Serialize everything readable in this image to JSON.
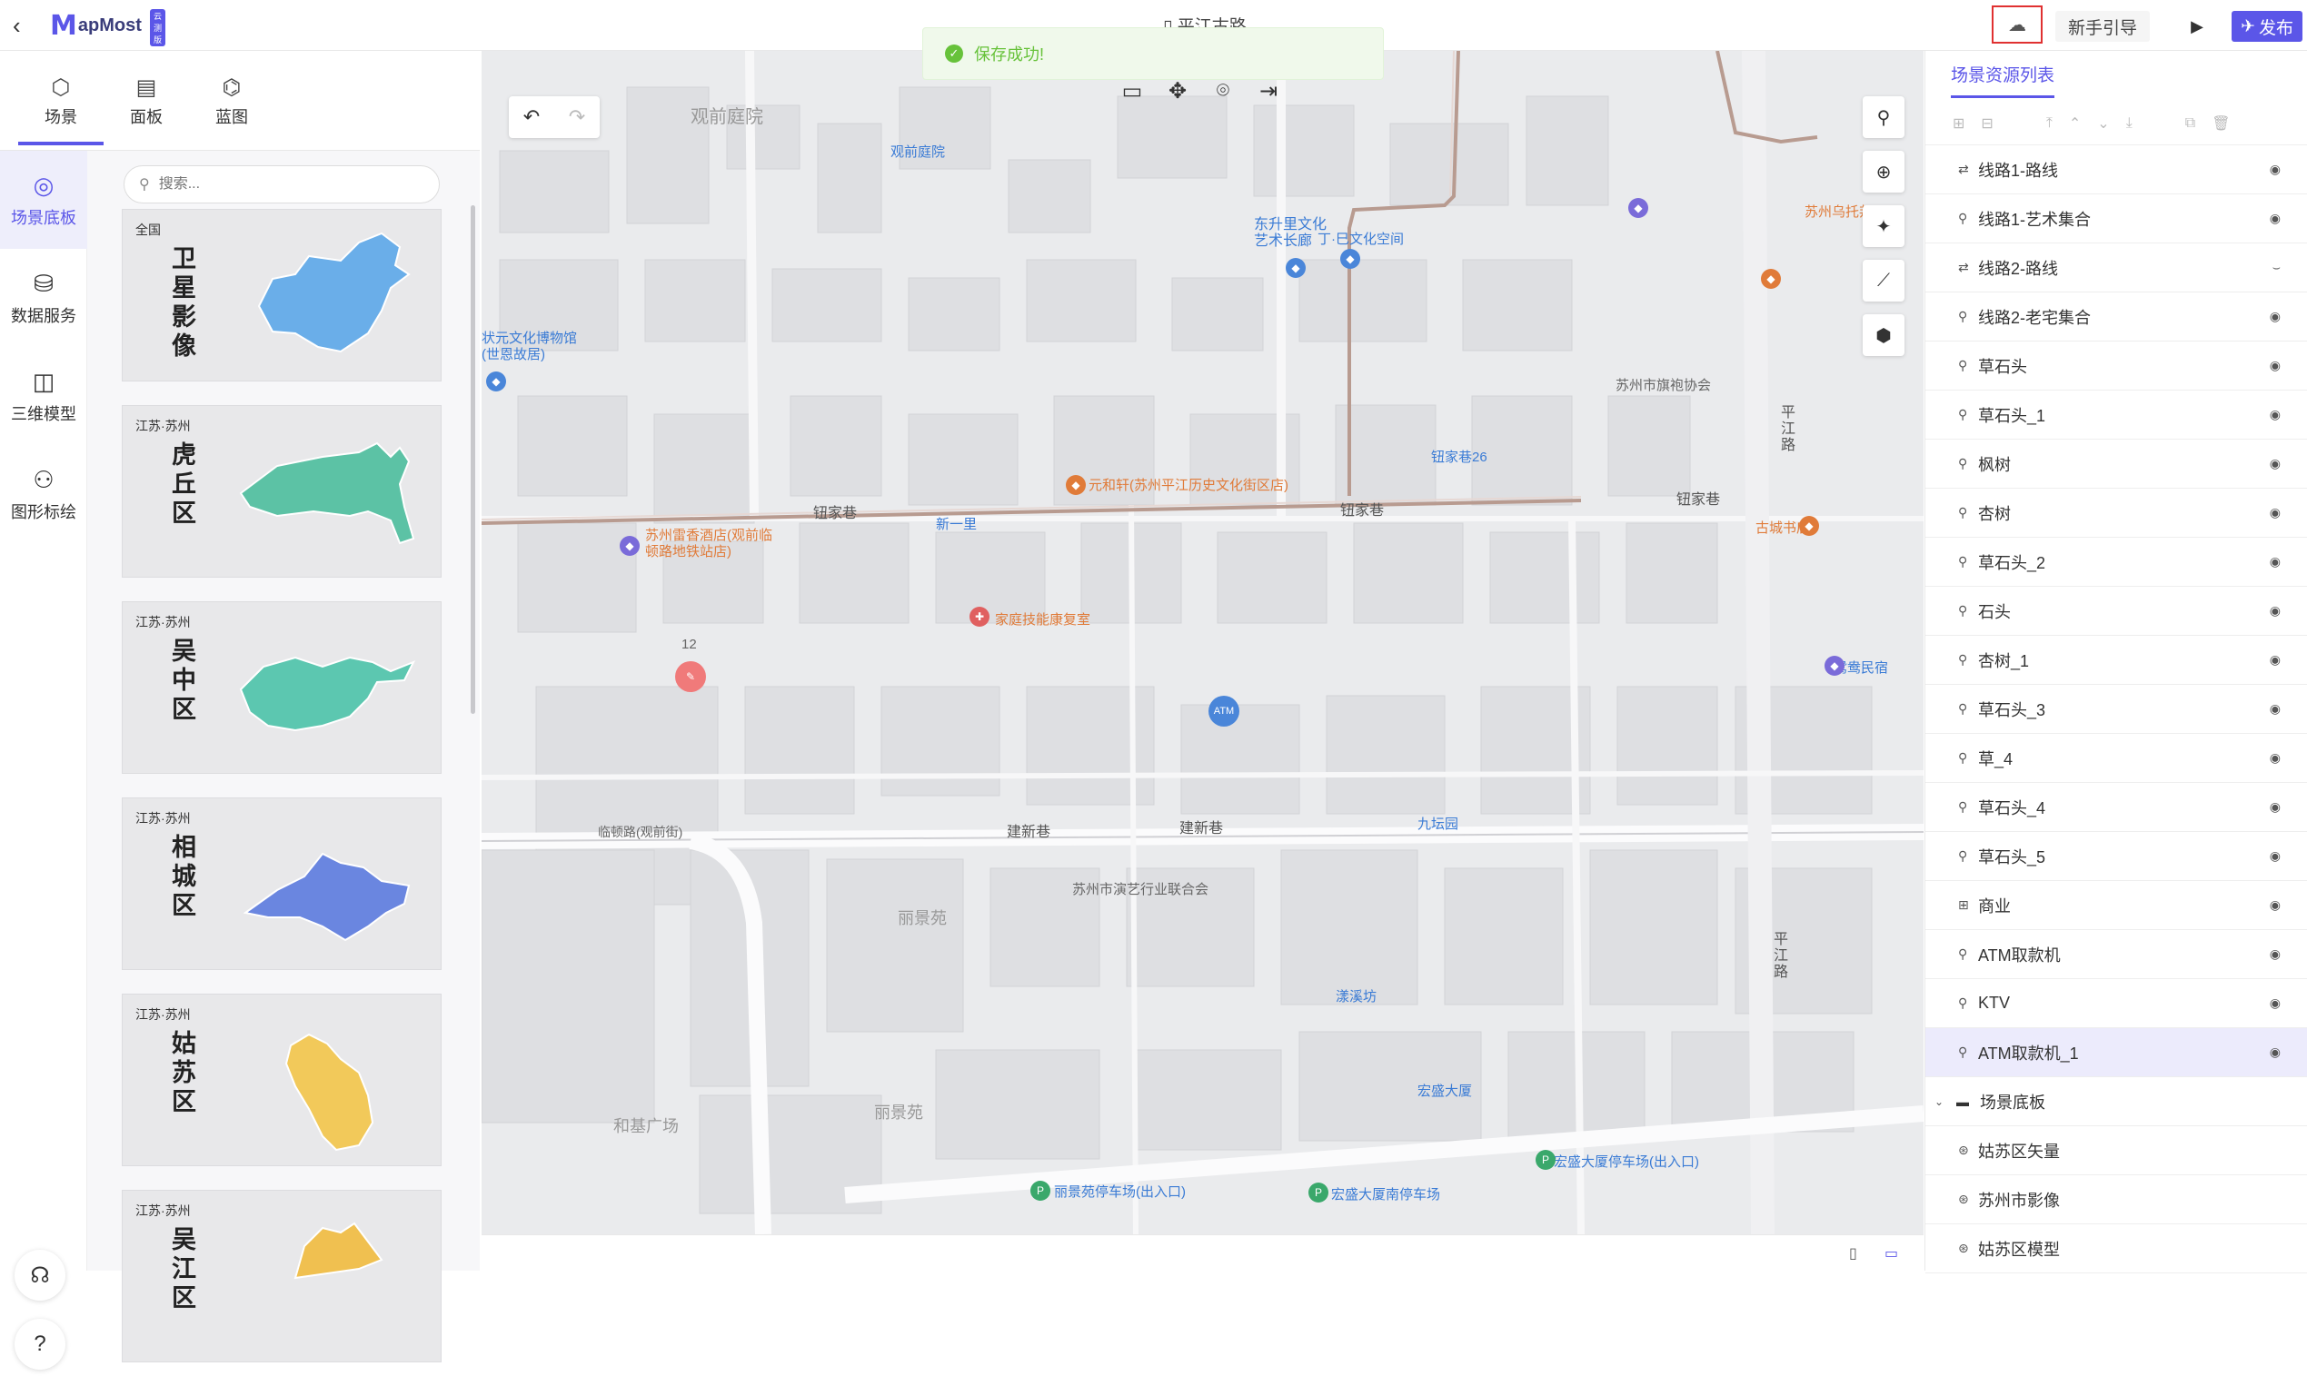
{
  "app": {
    "logo_text": "apMost",
    "logo_letter": "M",
    "logo_badge": "云测版",
    "document_title": "平江古路"
  },
  "toast": {
    "message": "保存成功!"
  },
  "header": {
    "guide_label": "新手引导",
    "publish_label": "发布"
  },
  "tabs": [
    {
      "label": "场景",
      "icon": "scene-icon"
    },
    {
      "label": "面板",
      "icon": "panel-icon"
    },
    {
      "label": "蓝图",
      "icon": "blueprint-icon"
    }
  ],
  "nav": [
    {
      "label": "场景底板",
      "icon": "globe-icon"
    },
    {
      "label": "数据服务",
      "icon": "database-icon"
    },
    {
      "label": "三维模型",
      "icon": "cube-icon"
    },
    {
      "label": "图形标绘",
      "icon": "shapes-icon"
    }
  ],
  "search": {
    "placeholder": "搜索..."
  },
  "cards": [
    {
      "region": "全国",
      "name": "卫星影像",
      "color": "#6aaee9"
    },
    {
      "region": "江苏·苏州",
      "name": "虎丘区",
      "color": "#5cc2a5"
    },
    {
      "region": "江苏·苏州",
      "name": "吴中区",
      "color": "#5cc7b0"
    },
    {
      "region": "江苏·苏州",
      "name": "相城区",
      "color": "#6a86e0"
    },
    {
      "region": "江苏·苏州",
      "name": "姑苏区",
      "color": "#f2c95a"
    },
    {
      "region": "江苏·苏州",
      "name": "吴江区",
      "color": "#f0c050"
    }
  ],
  "map": {
    "labels": [
      {
        "t": "观前庭院",
        "c": ""
      },
      {
        "t": "观前庭院",
        "c": "blue"
      },
      {
        "t": "东升里文化艺术长廊",
        "c": "blue"
      },
      {
        "t": "丁·巳文化空间",
        "c": "blue"
      },
      {
        "t": "状元文化博物馆(世恩故居)",
        "c": "blue"
      },
      {
        "t": "元和轩(苏州平江历史文化街区店)",
        "c": "poi"
      },
      {
        "t": "钮家巷",
        "c": "road"
      },
      {
        "t": "钮家巷",
        "c": "road"
      },
      {
        "t": "钮家巷",
        "c": "road"
      },
      {
        "t": "苏州雷香酒店(观前临顿路地铁站店)",
        "c": "poi"
      },
      {
        "t": "新一里",
        "c": "blue"
      },
      {
        "t": "家庭技能康复室",
        "c": "poi"
      },
      {
        "t": "苏州市旗袍协会",
        "c": ""
      },
      {
        "t": "古城书店",
        "c": "poi"
      },
      {
        "t": "平江路",
        "c": "road"
      },
      {
        "t": "平江路",
        "c": "road"
      },
      {
        "t": "建新巷",
        "c": "road"
      },
      {
        "t": "建新巷",
        "c": "road"
      },
      {
        "t": "苏州市演艺行业联合会",
        "c": ""
      },
      {
        "t": "丽景苑",
        "c": ""
      },
      {
        "t": "丽景苑",
        "c": ""
      },
      {
        "t": "和基广场",
        "c": ""
      },
      {
        "t": "九坛园",
        "c": "blue"
      },
      {
        "t": "宏盛大厦",
        "c": "blue"
      },
      {
        "t": "宏盛大厦停车场(出入口)",
        "c": "blue"
      },
      {
        "t": "丽景苑停车场(出入口)",
        "c": "blue"
      },
      {
        "t": "宏盛大厦南停车场",
        "c": "blue"
      },
      {
        "t": "苏州乌托邦",
        "c": "poi"
      },
      {
        "t": "鸳鸯民宿",
        "c": "blue"
      },
      {
        "t": "临顿路(观前街)",
        "c": ""
      },
      {
        "t": "钮家巷26",
        "c": "blue"
      },
      {
        "t": "漾溪坊",
        "c": "blue"
      },
      {
        "t": "ATM",
        "c": ""
      },
      {
        "t": "12",
        "c": ""
      }
    ]
  },
  "right_panel": {
    "title": "场景资源列表",
    "items": [
      {
        "label": "线路1-路线",
        "type": "route",
        "visible": true
      },
      {
        "label": "线路1-艺术集合",
        "type": "marker",
        "visible": true
      },
      {
        "label": "线路2-路线",
        "type": "route",
        "visible": false
      },
      {
        "label": "线路2-老宅集合",
        "type": "marker",
        "visible": true
      },
      {
        "label": "草石头",
        "type": "marker",
        "visible": true
      },
      {
        "label": "草石头_1",
        "type": "marker",
        "visible": true
      },
      {
        "label": "枫树",
        "type": "marker",
        "visible": true
      },
      {
        "label": "杏树",
        "type": "marker",
        "visible": true
      },
      {
        "label": "草石头_2",
        "type": "marker",
        "visible": true
      },
      {
        "label": "石头",
        "type": "marker",
        "visible": true
      },
      {
        "label": "杏树_1",
        "type": "marker",
        "visible": true
      },
      {
        "label": "草石头_3",
        "type": "marker",
        "visible": true
      },
      {
        "label": "草_4",
        "type": "marker",
        "visible": true
      },
      {
        "label": "草石头_4",
        "type": "marker",
        "visible": true
      },
      {
        "label": "草石头_5",
        "type": "marker",
        "visible": true
      },
      {
        "label": "商业",
        "type": "collection",
        "visible": true
      },
      {
        "label": "ATM取款机",
        "type": "marker",
        "visible": true
      },
      {
        "label": "KTV",
        "type": "marker",
        "visible": true
      },
      {
        "label": "ATM取款机_1",
        "type": "marker",
        "visible": true,
        "selected": true
      }
    ],
    "group": {
      "label": "场景底板",
      "children": [
        "姑苏区矢量",
        "苏州市影像",
        "姑苏区模型"
      ]
    }
  }
}
